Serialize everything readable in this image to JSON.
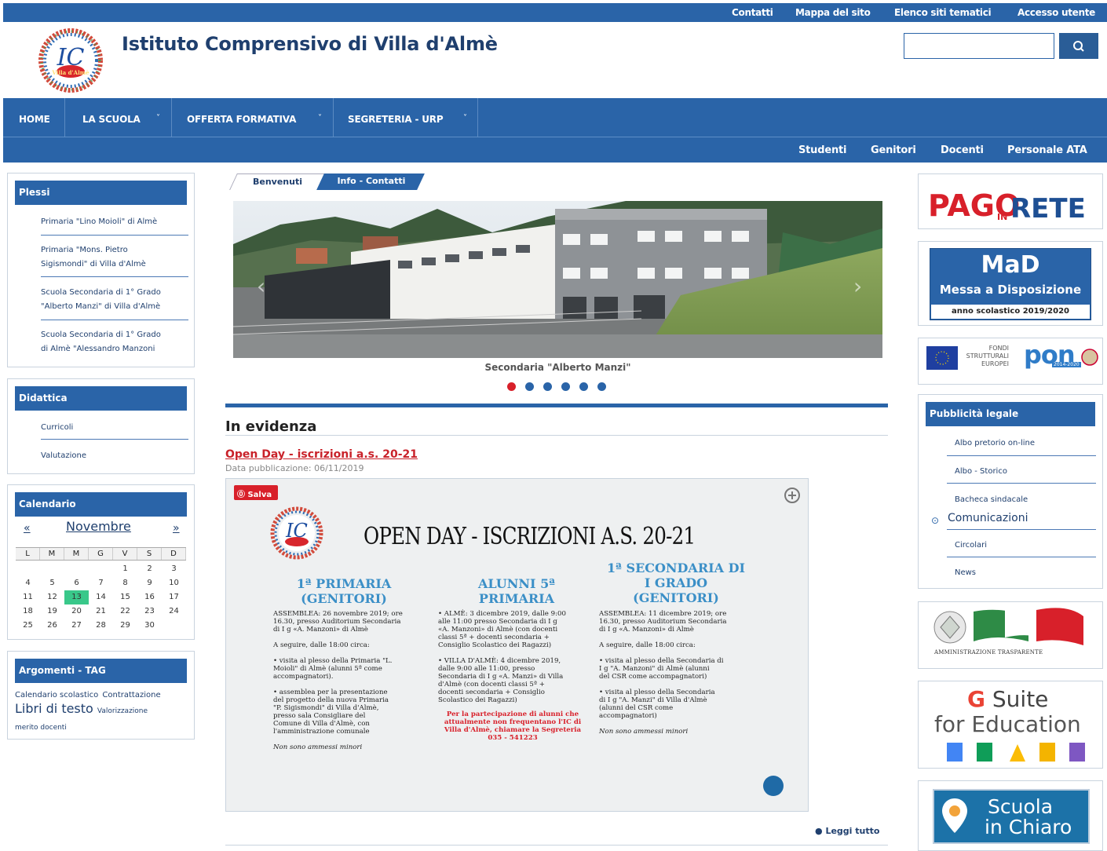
{
  "topbar": {
    "links": [
      "Contatti",
      "Mappa del sito",
      "Elenco siti tematici",
      "Accesso utente"
    ]
  },
  "header": {
    "title": "Istituto Comprensivo di Villa d'Almè",
    "logo_text": "IC",
    "logo_sub": "Villa d'Almè",
    "search_placeholder": "",
    "search_icon": "search-icon"
  },
  "mainnav": {
    "items": [
      "HOME",
      "LA SCUOLA",
      "OFFERTA FORMATIVA",
      "SEGRETERIA - URP"
    ],
    "chevron": "˅"
  },
  "secnav": {
    "items": [
      "Studenti",
      "Genitori",
      "Docenti",
      "Personale ATA"
    ]
  },
  "plessi": {
    "title": "Plessi",
    "items": [
      [
        "Primaria \"Lino Moioli\" di Almè"
      ],
      [
        "Primaria \"Mons. Pietro",
        "Sigismondi\" di Villa d'Almè"
      ],
      [
        "Scuola Secondaria di 1° Grado",
        "\"Alberto Manzi\" di Villa d'Almè"
      ],
      [
        "Scuola Secondaria di 1° Grado",
        "di Almè \"Alessandro Manzoni"
      ]
    ]
  },
  "didattica": {
    "title": "Didattica",
    "items": [
      "Curricoli",
      "Valutazione"
    ]
  },
  "calendario": {
    "title": "Calendario",
    "prev": "«",
    "next": "»",
    "month": "Novembre",
    "weekdays": [
      "L",
      "M",
      "M",
      "G",
      "V",
      "S",
      "D"
    ],
    "weeks": [
      [
        "",
        "",
        "",
        "",
        "1",
        "2",
        "3"
      ],
      [
        "4",
        "5",
        "6",
        "7",
        "8",
        "9",
        "10"
      ],
      [
        "11",
        "12",
        "13",
        "14",
        "15",
        "16",
        "17"
      ],
      [
        "18",
        "19",
        "20",
        "21",
        "22",
        "23",
        "24"
      ],
      [
        "25",
        "26",
        "27",
        "28",
        "29",
        "30",
        ""
      ]
    ],
    "today": "13"
  },
  "argomenti": {
    "title": "Argomenti - TAG",
    "tags": [
      "Calendario scolastico",
      "Contrattazione",
      "Libri di testo",
      "Valorizzazione",
      "merito docenti"
    ]
  },
  "tabs": {
    "benvenuti": "Benvenuti",
    "info": "Info - Contatti"
  },
  "slider": {
    "caption": "Secondaria \"Alberto Manzi\"",
    "dots": 6,
    "active_dot": 0,
    "active_color": "#d8202a",
    "dot_color": "#2a64a8"
  },
  "evidenza": {
    "heading": "In evidenza",
    "news_title": "Open Day - iscrizioni a.s. 20-21",
    "date": "Data pubblicazione: 06/11/2019",
    "read_more": "Leggi tutto"
  },
  "poster": {
    "save_label": "Salva",
    "headline": "OPEN DAY - ISCRIZIONI A.S. 20-21",
    "col1_title": [
      "1ª PRIMARIA",
      "(GENITORI)"
    ],
    "col2_title": [
      "ALUNNI 5ª",
      "PRIMARIA"
    ],
    "col3_title": [
      "1ª SECONDARIA DI",
      "I GRADO",
      "(GENITORI)"
    ],
    "col1_body": [
      "ASSEMBLEA: 26 novembre 2019; ore",
      "16.30, presso Auditorium Secondaria",
      "di I g «A. Manzoni» di Almè",
      "",
      "A seguire, dalle 18:00 circa:",
      "",
      "•   visita al plesso della Primaria \"L.",
      "    Moioli\" di Almè (alunni 5ª come",
      "    accompagnatori).",
      "",
      "•   assemblea per la presentazione",
      "    del progetto della nuova Primaria",
      "    \"P. Sigismondi\" di Villa d'Almè,",
      "    presso sala Consigliare del",
      "    Comune di Villa d'Almè, con",
      "    l'amministrazione comunale",
      "",
      "         Non sono ammessi minori"
    ],
    "col2_body": [
      "•  ALMÈ: 3 dicembre 2019, dalle 9:00",
      "   alle 11:00 presso Secondaria di I g",
      "   «A. Manzoni» di Almè (con docenti",
      "   classi 5ª + docenti secondaria +",
      "   Consiglio Scolastico dei Ragazzi)",
      "",
      "•  VILLA D'ALMÈ: 4 dicembre 2019,",
      "   dalle 9:00 alle 11:00, presso",
      "   Secondaria di I g «A. Manzi» di Villa",
      "   d'Almè (con docenti classi 5ª +",
      "   docenti secondaria + Consiglio",
      "   Scolastico dei Ragazzi)"
    ],
    "col2_note": [
      "Per la partecipazione di alunni che",
      "attualmente non frequentano l'IC di",
      "Villa d'Almè, chiamare la Segreteria",
      "035 - 541223"
    ],
    "col3_body": [
      "ASSEMBLEA: 11 dicembre 2019; ore",
      "16.30, presso Auditorium Secondaria",
      "di I g «A. Manzoni» di Almè",
      "",
      "A seguire, dalle 18:00 circa:",
      "",
      "•   visita al plesso della Secondaria di",
      "    I g \"A. Manzoni\" di Almè (alunni",
      "    del CSR come accompagnatori)",
      "",
      "•   visita al plesso della Secondaria",
      "    di I g \"A. Manzi\" di Villa d'Almè",
      "    (alunni del CSR come",
      "    accompagnatori)",
      "",
      "         Non sono ammessi minori"
    ]
  },
  "right": {
    "pago_text1": "PAGO",
    "pago_in": "IN",
    "pago_text2": "RETE",
    "mad_title": "MaD",
    "mad_sub": "Messa a Disposizione",
    "mad_year": "anno scolastico 2019/2020",
    "pon_fondi": [
      "FONDI",
      "STRUTTURALI",
      "EUROPEI"
    ],
    "pon_text": "pon",
    "pon_years": "2014-2020",
    "pubblicita": {
      "title": "Pubblicità legale",
      "items": [
        "Albo pretorio on-line",
        "Albo - Storico",
        "Bacheca sindacale",
        "Comunicazioni",
        "Circolari",
        "News"
      ],
      "active": "Comunicazioni"
    },
    "amm_text": "AMMINISTRAZIONE TRASPARENTE",
    "gsuite1": "Suite",
    "gsuite2": "for Education",
    "scuola_chiaro": [
      "Scuola",
      "in Chiaro"
    ]
  }
}
